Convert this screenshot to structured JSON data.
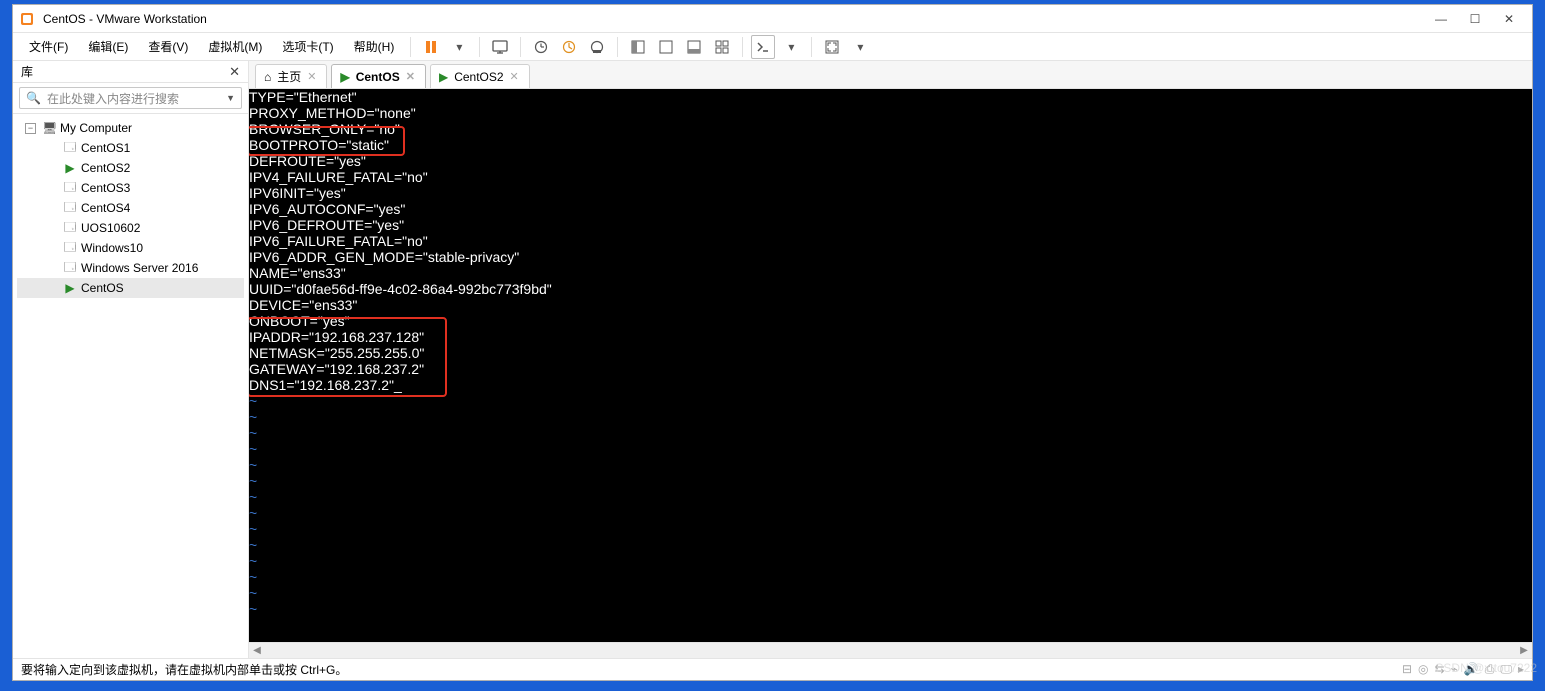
{
  "window": {
    "title": "CentOS  - VMware Workstation"
  },
  "menu": {
    "file": "文件(F)",
    "edit": "编辑(E)",
    "view": "查看(V)",
    "vm": "虚拟机(M)",
    "tabs": "选项卡(T)",
    "help": "帮助(H)"
  },
  "sidebar": {
    "title": "库",
    "search_placeholder": "在此处键入内容进行搜索",
    "root": "My Computer",
    "items": [
      {
        "label": "CentOS1"
      },
      {
        "label": "CentOS2"
      },
      {
        "label": "CentOS3"
      },
      {
        "label": "CentOS4"
      },
      {
        "label": "UOS10602"
      },
      {
        "label": "Windows10"
      },
      {
        "label": "Windows Server 2016"
      },
      {
        "label": "CentOS"
      }
    ]
  },
  "tabs": {
    "home": "主页",
    "centos": "CentOS",
    "centos2": "CentOS2"
  },
  "terminal": {
    "lines": [
      "TYPE=\"Ethernet\"",
      "PROXY_METHOD=\"none\"",
      "BROWSER_ONLY=\"no\"",
      "BOOTPROTO=\"static\"",
      "DEFROUTE=\"yes\"",
      "IPV4_FAILURE_FATAL=\"no\"",
      "IPV6INIT=\"yes\"",
      "IPV6_AUTOCONF=\"yes\"",
      "IPV6_DEFROUTE=\"yes\"",
      "IPV6_FAILURE_FATAL=\"no\"",
      "IPV6_ADDR_GEN_MODE=\"stable-privacy\"",
      "NAME=\"ens33\"",
      "UUID=\"d0fae56d-ff9e-4c02-86a4-992bc773f9bd\"",
      "DEVICE=\"ens33\"",
      "ONBOOT=\"yes\"",
      "IPADDR=\"192.168.237.128\"",
      "NETMASK=\"255.255.255.0\"",
      "GATEWAY=\"192.168.237.2\"",
      "DNS1=\"192.168.237.2\"_"
    ],
    "tilde": "~"
  },
  "status": {
    "text": "要将输入定向到该虚拟机，请在虚拟机内部单击或按 Ctrl+G。"
  },
  "watermark": "CSDN @xttou7222"
}
